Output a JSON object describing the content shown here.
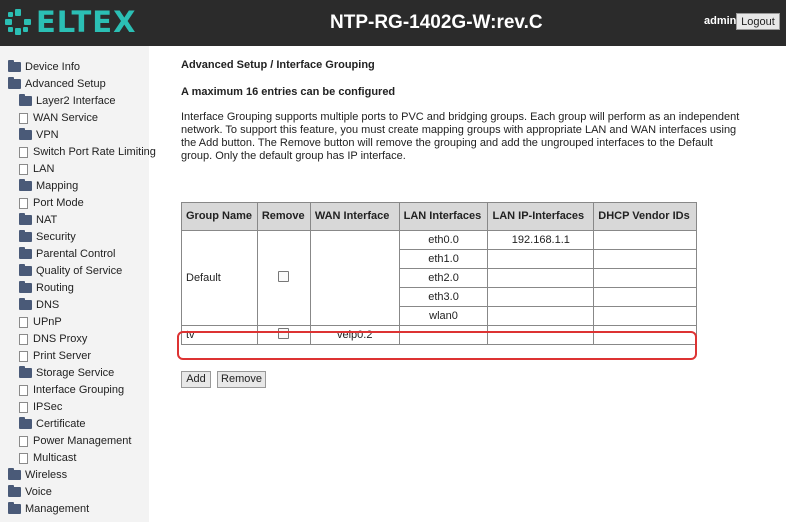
{
  "header": {
    "logo_text": "ELTEX",
    "title": "NTP-RG-1402G-W:rev.C",
    "user": "admin",
    "logout_label": "Logout"
  },
  "sidebar": {
    "items": [
      {
        "label": "Device Info",
        "level": 0,
        "icon": "folder-icon"
      },
      {
        "label": "Advanced Setup",
        "level": 0,
        "icon": "folder-icon"
      },
      {
        "label": "Layer2 Interface",
        "level": 1,
        "icon": "folder-icon"
      },
      {
        "label": "WAN Service",
        "level": 1,
        "icon": "document-icon"
      },
      {
        "label": "VPN",
        "level": 1,
        "icon": "folder-icon"
      },
      {
        "label": "Switch Port Rate Limiting",
        "level": 1,
        "icon": "document-icon"
      },
      {
        "label": "LAN",
        "level": 1,
        "icon": "document-icon"
      },
      {
        "label": "Mapping",
        "level": 1,
        "icon": "folder-icon"
      },
      {
        "label": "Port Mode",
        "level": 1,
        "icon": "document-icon"
      },
      {
        "label": "NAT",
        "level": 1,
        "icon": "folder-icon"
      },
      {
        "label": "Security",
        "level": 1,
        "icon": "folder-icon"
      },
      {
        "label": "Parental Control",
        "level": 1,
        "icon": "folder-icon"
      },
      {
        "label": "Quality of Service",
        "level": 1,
        "icon": "folder-icon"
      },
      {
        "label": "Routing",
        "level": 1,
        "icon": "folder-icon"
      },
      {
        "label": "DNS",
        "level": 1,
        "icon": "folder-icon"
      },
      {
        "label": "UPnP",
        "level": 1,
        "icon": "document-icon"
      },
      {
        "label": "DNS Proxy",
        "level": 1,
        "icon": "document-icon"
      },
      {
        "label": "Print Server",
        "level": 1,
        "icon": "document-icon"
      },
      {
        "label": "Storage Service",
        "level": 1,
        "icon": "folder-icon"
      },
      {
        "label": "Interface Grouping",
        "level": 1,
        "icon": "document-icon"
      },
      {
        "label": "IPSec",
        "level": 1,
        "icon": "document-icon"
      },
      {
        "label": "Certificate",
        "level": 1,
        "icon": "folder-icon"
      },
      {
        "label": "Power Management",
        "level": 1,
        "icon": "document-icon"
      },
      {
        "label": "Multicast",
        "level": 1,
        "icon": "document-icon"
      },
      {
        "label": "Wireless",
        "level": 0,
        "icon": "folder-icon"
      },
      {
        "label": "Voice",
        "level": 0,
        "icon": "folder-icon"
      },
      {
        "label": "Management",
        "level": 0,
        "icon": "folder-icon"
      }
    ]
  },
  "main": {
    "breadcrumb": "Advanced Setup / Interface Grouping",
    "max_entries": "A maximum 16 entries can be configured",
    "description": "Interface Grouping supports multiple ports to PVC and bridging groups. Each group will perform as an independent network. To support this feature, you must create mapping groups with appropriate LAN and WAN interfaces using the Add button. The Remove button will remove the grouping and add the ungrouped interfaces to the Default group. Only the default group has IP interface.",
    "table": {
      "headers": [
        "Group Name",
        "Remove",
        "WAN Interface",
        "LAN Interfaces",
        "LAN IP-Interfaces",
        "DHCP Vendor IDs"
      ],
      "default_group": {
        "name": "Default",
        "lan_interfaces": [
          "eth0.0",
          "eth1.0",
          "eth2.0",
          "eth3.0",
          "wlan0"
        ],
        "lan_ip": "192.168.1.1"
      },
      "tv_group": {
        "name": "tv",
        "wan_interface": "veip0.2"
      }
    },
    "add_label": "Add",
    "remove_label": "Remove"
  }
}
